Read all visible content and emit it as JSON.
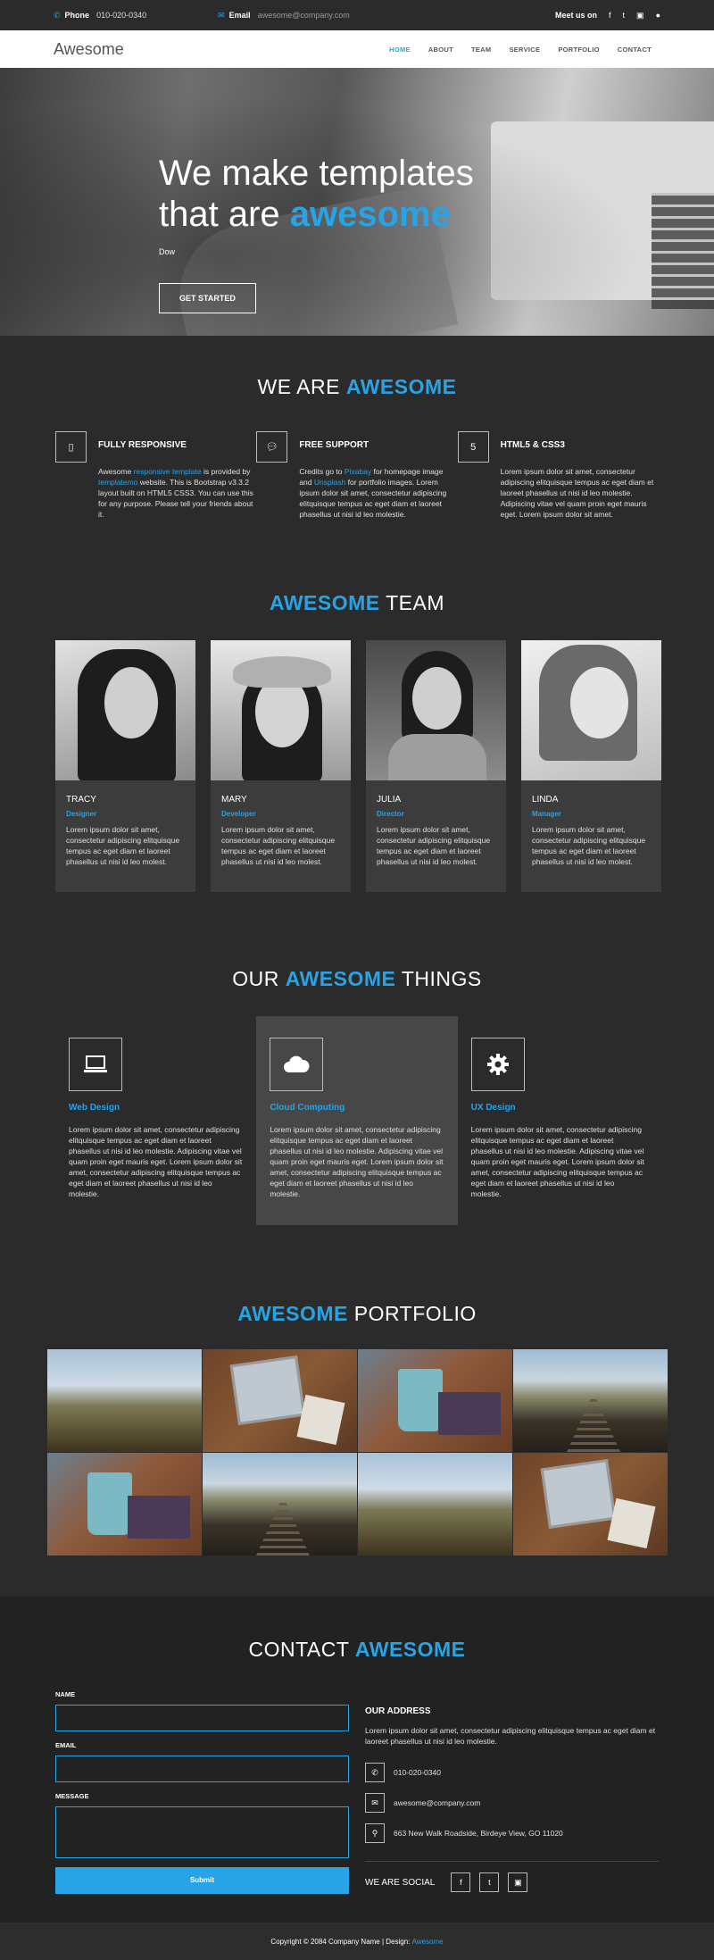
{
  "topbar": {
    "phone_label": "Phone",
    "phone_value": "010-020-0340",
    "email_label": "Email",
    "email_value": "awesome@company.com",
    "meet_label": "Meet us on",
    "social_icons": [
      "facebook-icon",
      "twitter-icon",
      "instagram-icon",
      "apple-icon"
    ]
  },
  "nav": {
    "brand": "Awesome",
    "items": [
      "HOME",
      "ABOUT",
      "TEAM",
      "SERVICE",
      "PORTFOLIO",
      "CONTACT"
    ],
    "active_index": 0
  },
  "hero": {
    "line1": "We make templates",
    "line2_prefix": "that are ",
    "line2_accent": "awesome",
    "sub": "Dow",
    "button": "GET STARTED"
  },
  "features": {
    "title_plain": "WE ARE ",
    "title_accent": "AWESOME",
    "items": [
      {
        "icon": "mobile-icon",
        "title": "FULLY RESPONSIVE",
        "text_1": "Awesome ",
        "link_1": "responsive template",
        "text_2": " is provided by ",
        "link_2": "templatemo",
        "text_3": " website. This is Bootstrap v3.3.2 layout built on HTML5 CSS3. You can use this for any purpose. Please tell your friends about it."
      },
      {
        "icon": "chat-bubble-icon",
        "title": "FREE SUPPORT",
        "text_1": "Credits go to ",
        "link_1": "Pixabay",
        "text_2": " for homepage image and ",
        "link_2": "Unsplash",
        "text_3": " for portfolio images. Lorem ipsum dolor sit amet, consectetur adipiscing elitquisque tempus ac eget diam et laoreet phasellus ut nisi id leo molestie."
      },
      {
        "icon": "html5-icon",
        "title": "HTML5 & CSS3",
        "text_1": "Lorem ipsum dolor sit amet, consectetur adipiscing elitquisque tempus ac eget diam et laoreet phasellus ut nisi id leo molestie. Adipiscing vitae vel quam proin eget mauris eget. Lorem ipsum dolor sit amet.",
        "link_1": "",
        "text_2": "",
        "link_2": "",
        "text_3": ""
      }
    ]
  },
  "team": {
    "title_accent": "AWESOME",
    "title_plain": " TEAM",
    "members": [
      {
        "name": "TRACY",
        "role": "Designer",
        "text": "Lorem ipsum dolor sit amet, consectetur adipiscing elitquisque tempus ac eget diam et laoreet phasellus ut nisi id leo molest."
      },
      {
        "name": "MARY",
        "role": "Developer",
        "text": "Lorem ipsum dolor sit amet, consectetur adipiscing elitquisque tempus ac eget diam et laoreet phasellus ut nisi id leo molest."
      },
      {
        "name": "JULIA",
        "role": "Director",
        "text": "Lorem ipsum dolor sit amet, consectetur adipiscing elitquisque tempus ac eget diam et laoreet phasellus ut nisi id leo molest."
      },
      {
        "name": "LINDA",
        "role": "Manager",
        "text": "Lorem ipsum dolor sit amet, consectetur adipiscing elitquisque tempus ac eget diam et laoreet phasellus ut nisi id leo molest."
      }
    ]
  },
  "things": {
    "title_plain_1": "OUR ",
    "title_accent": "AWESOME",
    "title_plain_2": " THINGS",
    "items": [
      {
        "icon": "laptop-icon",
        "title": "Web Design",
        "text": "Lorem ipsum dolor sit amet, consectetur adipiscing elitquisque tempus ac eget diam et laoreet phasellus ut nisi id leo molestie. Adipiscing vitae vel quam proin eget mauris eget. Lorem ipsum dolor sit amet, consectetur adipiscing elitquisque tempus ac eget diam et laoreet phasellus ut nisi id leo molestie."
      },
      {
        "icon": "cloud-icon",
        "title": "Cloud Computing",
        "text": "Lorem ipsum dolor sit amet, consectetur adipiscing elitquisque tempus ac eget diam et laoreet phasellus ut nisi id leo molestie. Adipiscing vitae vel quam proin eget mauris eget. Lorem ipsum dolor sit amet, consectetur adipiscing elitquisque tempus ac eget diam et laoreet phasellus ut nisi id leo molestie."
      },
      {
        "icon": "gear-icon",
        "title": "UX Design",
        "text": "Lorem ipsum dolor sit amet, consectetur adipiscing elitquisque tempus ac eget diam et laoreet phasellus ut nisi id leo molestie. Adipiscing vitae vel quam proin eget mauris eget. Lorem ipsum dolor sit amet, consectetur adipiscing elitquisque tempus ac eget diam et laoreet phasellus ut nisi id leo molestie."
      }
    ]
  },
  "portfolio": {
    "title_accent": "AWESOME",
    "title_plain": " PORTFOLIO",
    "images": [
      "land",
      "laptop",
      "cup",
      "rail",
      "cup",
      "rail",
      "land",
      "laptop"
    ]
  },
  "contact": {
    "title_plain": "CONTACT ",
    "title_accent": "AWESOME",
    "name_label": "NAME",
    "email_label": "EMAIL",
    "message_label": "MESSAGE",
    "submit": "Submit",
    "address_title": "OUR ADDRESS",
    "address_text": "Lorem ipsum dolor sit amet, consectetur adipiscing elitquisque tempus ac eget diam et laoreet phasellus ut nisi id leo molestie.",
    "phone": "010-020-0340",
    "email": "awesome@company.com",
    "address": "663 New Walk Roadside, Birdeye View, GO 11020",
    "social_label": "WE ARE SOCIAL"
  },
  "footer": {
    "text": "Copyright © 2084 Company Name | Design: ",
    "link": "Awesome"
  },
  "colors": {
    "accent": "#27a3e6",
    "bg": "#2b2b2c",
    "panel": "#3c3c3d"
  }
}
